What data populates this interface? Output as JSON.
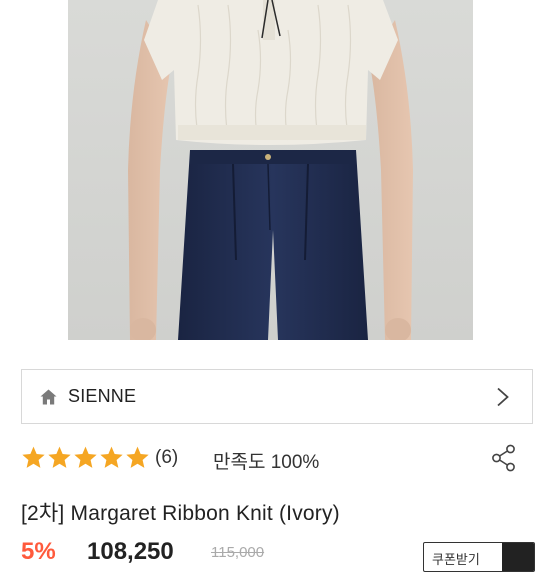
{
  "brand": {
    "name": "SIENNE"
  },
  "rating": {
    "stars": 5,
    "review_count": "(6)",
    "satisfaction": "만족도 100%"
  },
  "product": {
    "title": "[2차] Margaret Ribbon Knit (Ivory)"
  },
  "price": {
    "discount": "5%",
    "sale_price": "108,250",
    "original_price": "115,000",
    "coupon_label": "쿠폰받기"
  },
  "colors": {
    "star": "#f5a623",
    "discount": "#ff5a3c",
    "knit": "#efece4",
    "denim": "#1e2a4a"
  },
  "icons": [
    "home-icon",
    "chevron-right-icon",
    "star-icon",
    "share-icon"
  ]
}
